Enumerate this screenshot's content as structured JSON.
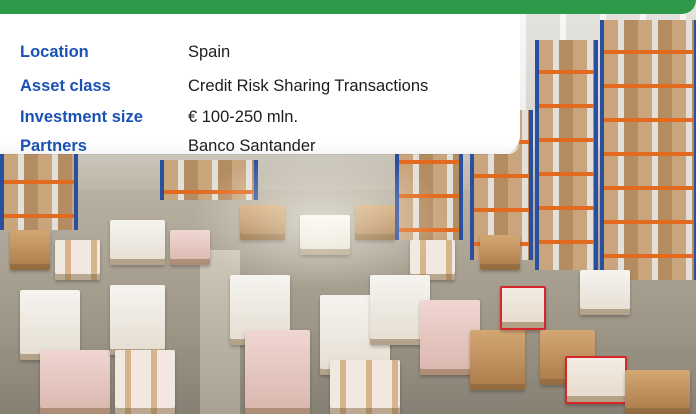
{
  "header": {
    "accent_color": "#2e9a49"
  },
  "details": {
    "label_color": "#1a52b4",
    "rows": [
      {
        "label": "Location",
        "value": "Spain"
      },
      {
        "label": "Asset class",
        "value": "Credit Risk Sharing Transactions"
      },
      {
        "label": "Investment size",
        "value": "€ 100-250 mln."
      },
      {
        "label": "Partners",
        "value": "Banco Santander"
      }
    ]
  },
  "photo": {
    "subject": "warehouse-interior"
  }
}
